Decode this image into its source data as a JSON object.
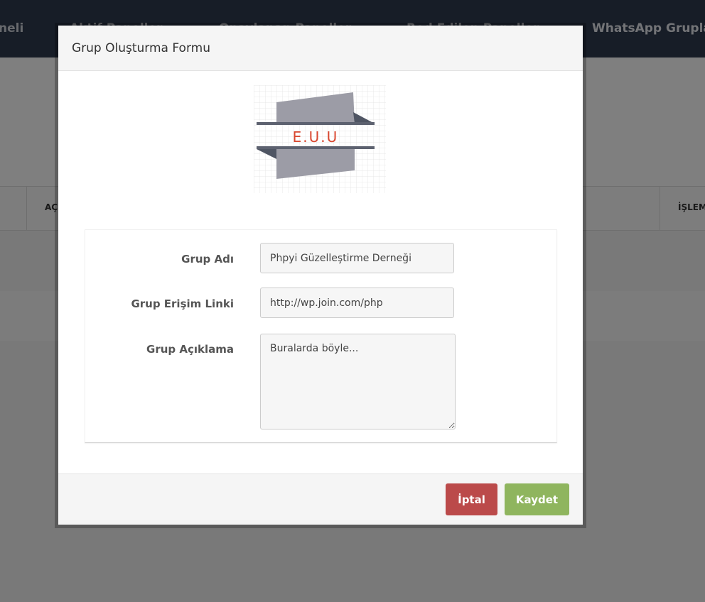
{
  "nav": {
    "items": [
      "neli",
      "Aktif Paneller",
      "Onaylanan Paneller",
      "Red Edilen Paneller",
      "WhatsApp Grupları"
    ]
  },
  "table": {
    "headers": [
      "AÇ",
      "İŞLEM"
    ]
  },
  "modal": {
    "title": "Grup Oluşturma Formu",
    "logo_text": "E.U.U",
    "fields": {
      "name_label": "Grup Adı",
      "name_value": "Phpyi Güzelleştirme Derneği",
      "link_label": "Grup Erişim Linki",
      "link_value": "http://wp.join.com/php",
      "desc_label": "Grup Açıklama",
      "desc_value": "Buralarda böyle..."
    },
    "buttons": {
      "cancel": "İptal",
      "save": "Kaydet"
    }
  },
  "colors": {
    "navbar": "#2f3a4f",
    "cancel": "#bb4a4a",
    "save": "#8fb55e",
    "logo_text": "#d9472f"
  }
}
